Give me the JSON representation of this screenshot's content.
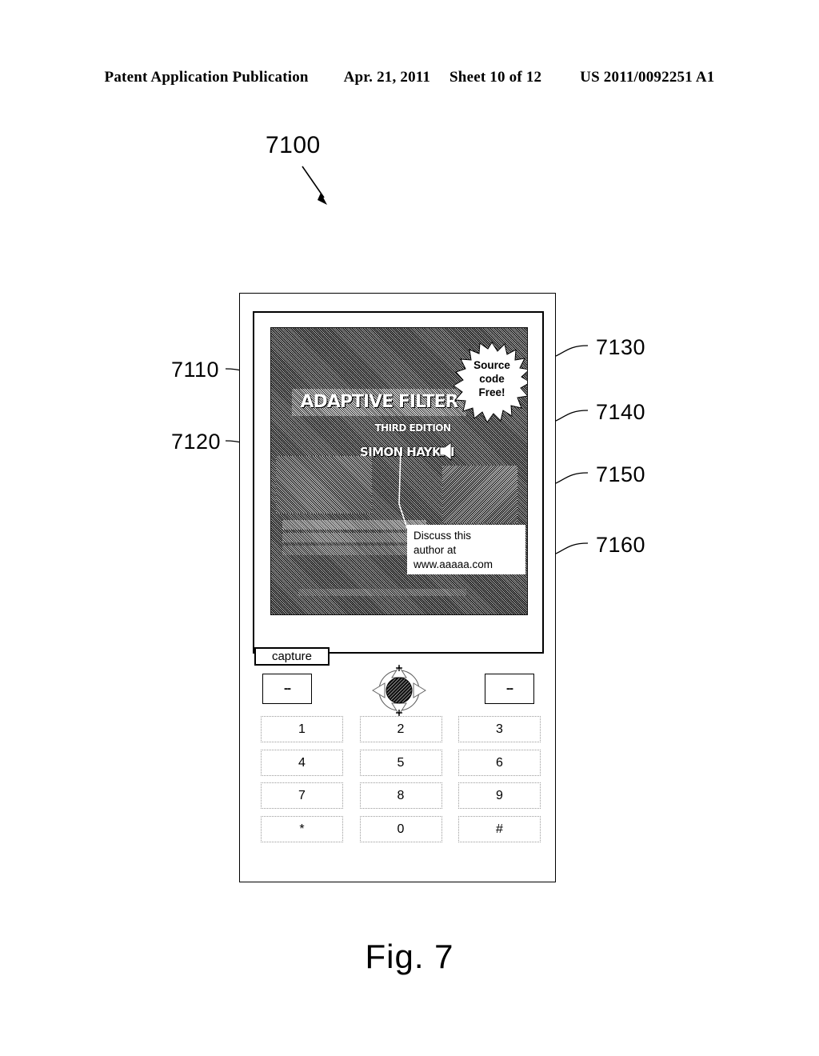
{
  "header": {
    "publication": "Patent Application Publication",
    "date": "Apr. 21, 2011",
    "sheet": "Sheet 10 of 12",
    "doc_number": "US 2011/0092251 A1"
  },
  "figure": {
    "caption": "Fig. 7",
    "device_ref": "7100"
  },
  "references": {
    "display_image": "7110",
    "cover_photo": "7120",
    "starburst": "7130",
    "background": "7140",
    "photo_inset": "7150",
    "discuss_callout": "7160"
  },
  "phone": {
    "screen": {
      "cover": {
        "title": "ADAPTIVE FILTER",
        "edition": "THIRD EDITION",
        "author": "SIMON HAYKIN",
        "speaker_icon": "speaker-icon"
      },
      "starburst": {
        "line1": "Source",
        "line2": "code",
        "line3": "Free!"
      },
      "discuss_callout": {
        "line1": "Discuss this",
        "line2": "author at",
        "line3": "www.aaaaa.com"
      }
    },
    "capture_button": "capture",
    "softkeys": {
      "left": "--",
      "right": "--"
    },
    "dpad": {
      "up": "up-arrow-icon",
      "down": "down-arrow-icon",
      "left": "left-arrow-icon",
      "right": "right-arrow-icon",
      "center": "select-button"
    },
    "keypad": {
      "rows": [
        [
          "1",
          "2",
          "3"
        ],
        [
          "4",
          "5",
          "6"
        ],
        [
          "7",
          "8",
          "9"
        ],
        [
          "*",
          "0",
          "#"
        ]
      ]
    }
  },
  "colors": {
    "ink": "#000000",
    "paper": "#ffffff",
    "key_border": "#9b9b9b"
  }
}
